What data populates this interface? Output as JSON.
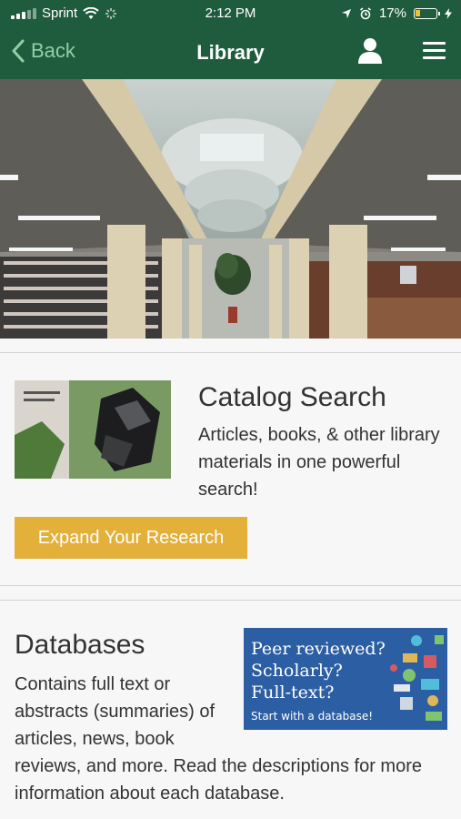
{
  "status_bar": {
    "carrier": "Sprint",
    "time": "2:12 PM",
    "battery_percent": "17%"
  },
  "nav": {
    "back_label": "Back",
    "title": "Library",
    "icons": [
      "user-icon",
      "menu-icon",
      "back-chevron-icon"
    ]
  },
  "catalog": {
    "title": "Catalog Search",
    "description": "Articles, books, & other library materials in one powerful search!",
    "button_label": "Expand Your Research"
  },
  "databases": {
    "title": "Databases",
    "description": "Contains full text or abstracts (summaries) of articles, news, book reviews, and more. Read the descriptions for more information about each database.",
    "banner": {
      "line1": "Peer reviewed?",
      "line2": "Scholarly?",
      "line3": "Full-text?",
      "cta": "Start with a database!"
    }
  },
  "colors": {
    "nav_bg": "#1f5c3d",
    "back_text": "#8fd1a7",
    "button_bg": "#e3b03a",
    "banner_bg": "#2c5ea3"
  }
}
